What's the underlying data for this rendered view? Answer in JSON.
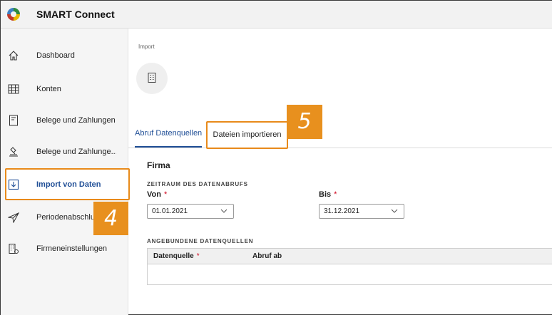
{
  "app": {
    "title": "SMART Connect"
  },
  "sidebar": {
    "items": [
      {
        "label": "Dashboard",
        "icon": "home-icon"
      },
      {
        "label": "Konten",
        "icon": "table-grid-icon"
      },
      {
        "label": "Belege und Zahlungen",
        "icon": "document-icon"
      },
      {
        "label": "Belege und Zahlunge...",
        "icon": "stamp-icon"
      },
      {
        "label": "Import von Daten",
        "icon": "import-icon",
        "active": true
      },
      {
        "label": "Periodenabschluss",
        "icon": "send-icon"
      },
      {
        "label": "Firmeneinstellungen",
        "icon": "building-settings-icon"
      }
    ]
  },
  "callouts": {
    "four": "4",
    "five": "5"
  },
  "main": {
    "breadcrumb": "Import",
    "tabs": [
      {
        "label": "Abruf Datenquellen",
        "active": true
      },
      {
        "label": "Dateien importieren",
        "active": false
      }
    ],
    "section_title": "Firma",
    "period_caption": "ZEITRAUM DES DATENABRUFS",
    "from_label": "Von",
    "from_value": "01.01.2021",
    "to_label": "Bis",
    "to_value": "31.12.2021",
    "required_marker": "*",
    "sources_caption": "ANGEBUNDENE DATENQUELLEN",
    "table_headers": {
      "source": "Datenquelle",
      "retrieve_from": "Abruf ab"
    }
  },
  "colors": {
    "accent_blue": "#1f4e96",
    "callout_orange": "#e8901e",
    "required_red": "#d0021b"
  }
}
